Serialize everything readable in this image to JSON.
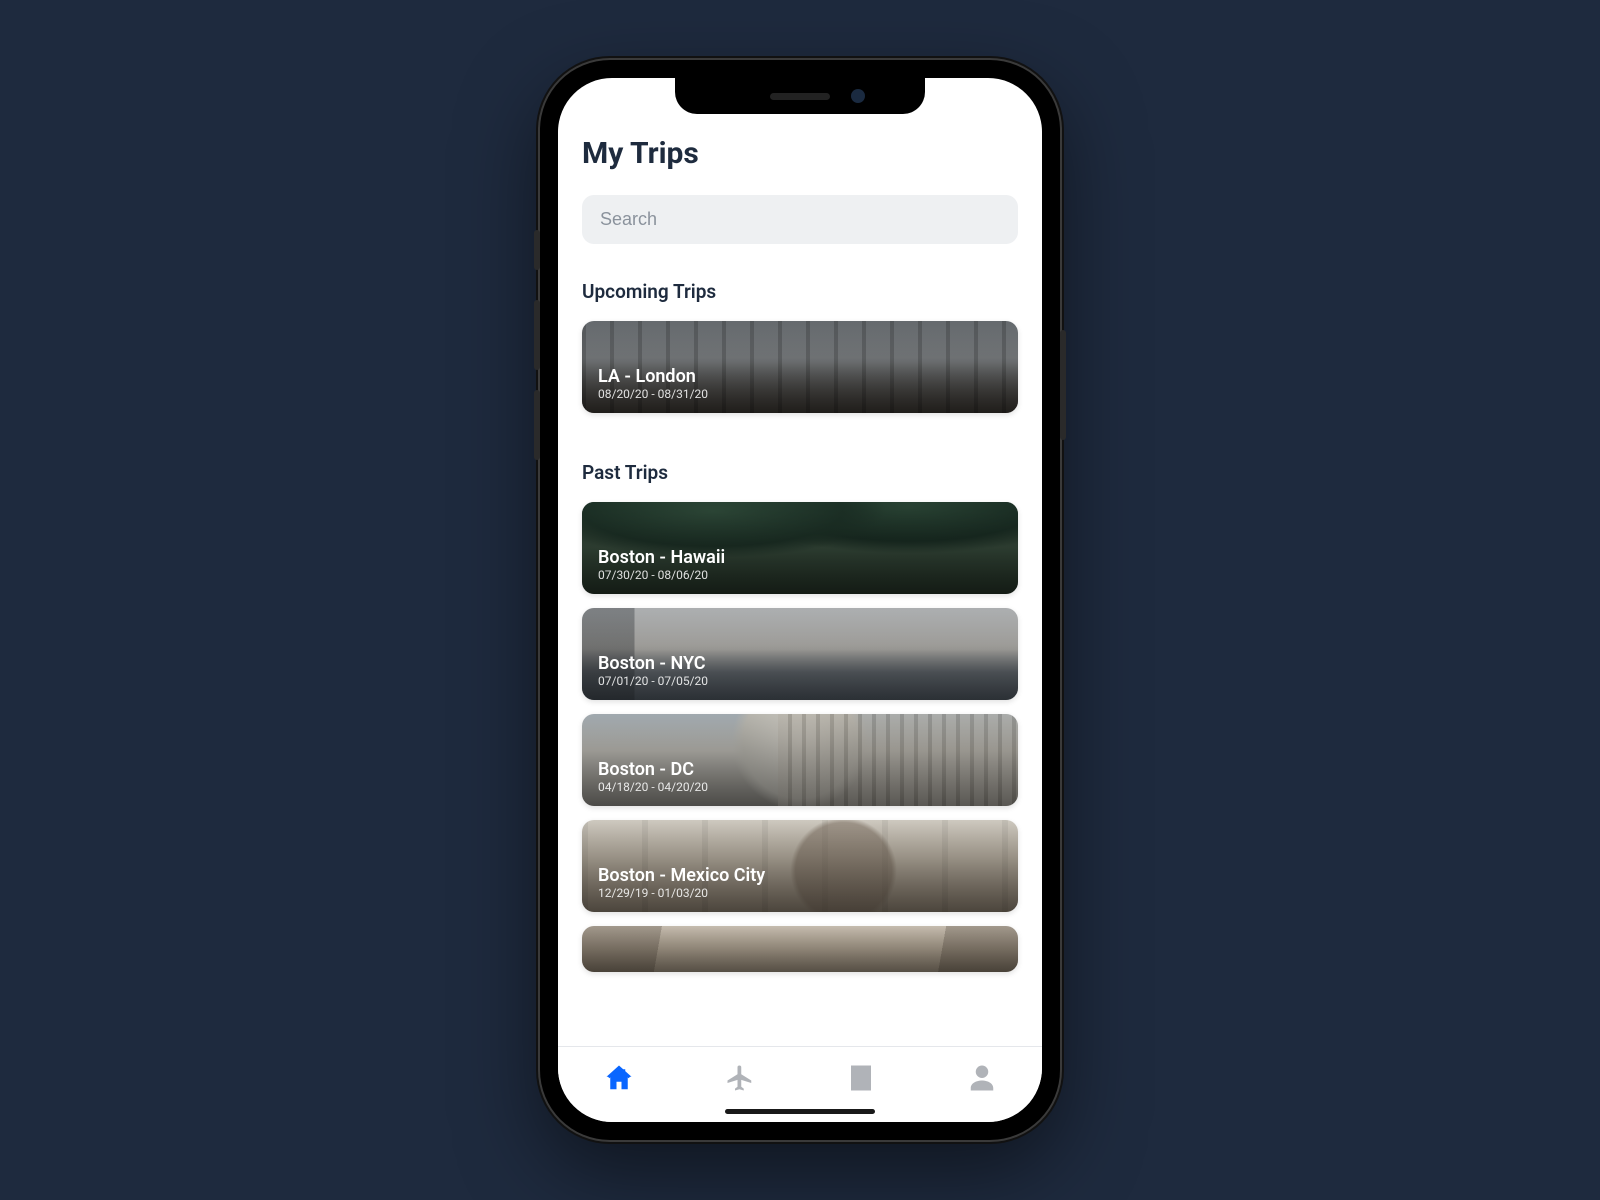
{
  "header": {
    "title": "My Trips"
  },
  "search": {
    "placeholder": "Search",
    "value": ""
  },
  "sections": {
    "upcoming": {
      "title": "Upcoming Trips",
      "trips": [
        {
          "title": "LA - London",
          "dates": "08/20/20 - 08/31/20",
          "bg": "bg-london"
        }
      ]
    },
    "past": {
      "title": "Past Trips",
      "trips": [
        {
          "title": "Boston - Hawaii",
          "dates": "07/30/20 - 08/06/20",
          "bg": "bg-hawaii"
        },
        {
          "title": "Boston - NYC",
          "dates": "07/01/20 - 07/05/20",
          "bg": "bg-nyc"
        },
        {
          "title": "Boston - DC",
          "dates": "04/18/20 - 04/20/20",
          "bg": "bg-dc"
        },
        {
          "title": "Boston - Mexico City",
          "dates": "12/29/19 - 01/03/20",
          "bg": "bg-mexico"
        }
      ],
      "cutoff": {
        "bg": "bg-extra"
      }
    }
  },
  "tabbar": {
    "items": [
      {
        "name": "home",
        "icon": "home-icon",
        "active": true
      },
      {
        "name": "flights",
        "icon": "plane-icon",
        "active": false
      },
      {
        "name": "hotels",
        "icon": "building-icon",
        "active": false
      },
      {
        "name": "profile",
        "icon": "person-icon",
        "active": false
      }
    ]
  },
  "colors": {
    "accent": "#0a66ff",
    "text_primary": "#1e2b3e",
    "muted": "#b0b3b8",
    "page_bg": "#1e2a3e"
  }
}
